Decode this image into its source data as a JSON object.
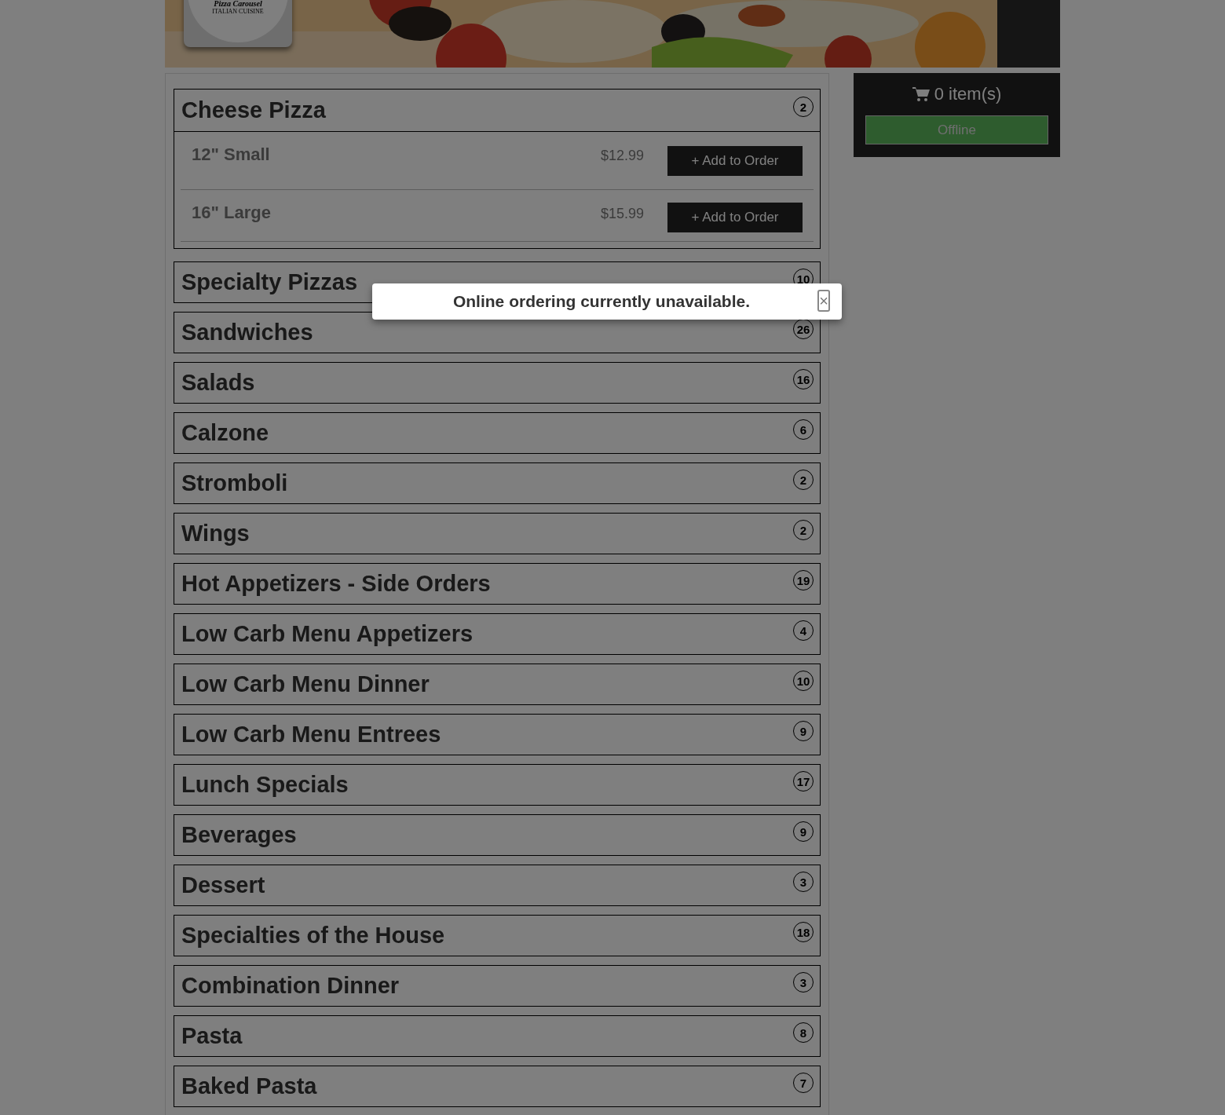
{
  "header": {
    "logo": {
      "name": "Pizza Carousel",
      "tagline": "ITALIAN CUISINE"
    }
  },
  "categories": [
    {
      "name": "Cheese Pizza",
      "count": "2",
      "expanded": true,
      "items": [
        {
          "name": "12\" Small",
          "price": "$12.99",
          "button": "+ Add to Order"
        },
        {
          "name": "16\" Large",
          "price": "$15.99",
          "button": "+ Add to Order"
        }
      ]
    },
    {
      "name": "Specialty Pizzas",
      "count": "10",
      "expanded": false
    },
    {
      "name": "Sandwiches",
      "count": "26",
      "expanded": false
    },
    {
      "name": "Salads",
      "count": "16",
      "expanded": false
    },
    {
      "name": "Calzone",
      "count": "6",
      "expanded": false
    },
    {
      "name": "Stromboli",
      "count": "2",
      "expanded": false
    },
    {
      "name": "Wings",
      "count": "2",
      "expanded": false
    },
    {
      "name": "Hot Appetizers - Side Orders",
      "count": "19",
      "expanded": false
    },
    {
      "name": "Low Carb Menu Appetizers",
      "count": "4",
      "expanded": false
    },
    {
      "name": "Low Carb Menu Dinner",
      "count": "10",
      "expanded": false
    },
    {
      "name": "Low Carb Menu Entrees",
      "count": "9",
      "expanded": false
    },
    {
      "name": "Lunch Specials",
      "count": "17",
      "expanded": false
    },
    {
      "name": "Beverages",
      "count": "9",
      "expanded": false
    },
    {
      "name": "Dessert",
      "count": "3",
      "expanded": false
    },
    {
      "name": "Specialties of the House",
      "count": "18",
      "expanded": false
    },
    {
      "name": "Combination Dinner",
      "count": "3",
      "expanded": false
    },
    {
      "name": "Pasta",
      "count": "8",
      "expanded": false
    },
    {
      "name": "Baked Pasta",
      "count": "7",
      "expanded": false
    }
  ],
  "cart": {
    "count": "0 item(s)",
    "button": "Offline"
  },
  "modal": {
    "message": "Online ordering currently unavailable.",
    "close": "×"
  }
}
